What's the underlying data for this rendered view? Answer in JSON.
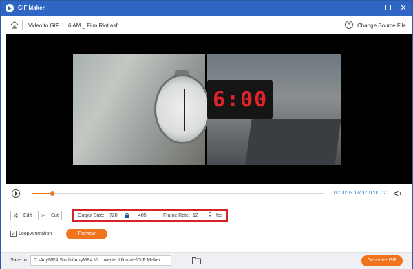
{
  "app": {
    "title": "GIF Maker",
    "max_glyph": "",
    "close_glyph": "✕"
  },
  "breadcrumb": {
    "section": "Video to GIF",
    "separator": "›",
    "file": "6 AM _ Film Riot.asf"
  },
  "header": {
    "change_source_label": "Change Source File",
    "change_source_glyph": "+"
  },
  "video": {
    "led_display": "6:00"
  },
  "player": {
    "current_time": "00:00:03.17",
    "total_time": "00:01:00.02",
    "time_display": "00:00:03.17/00:01:00.02",
    "progress_fraction": 0.07
  },
  "controls": {
    "edit_label": "Edit",
    "cut_label": "Cut",
    "output_size_label": "Output Size:",
    "output_width": "720",
    "output_height": "405",
    "frame_rate_label": "Frame Rate:",
    "frame_rate_value": "12",
    "frame_rate_unit": "fps",
    "loop_label": "Loop Animation",
    "loop_checked": true,
    "loop_glyph": "✓",
    "preview_label": "Preview"
  },
  "save": {
    "label": "Save to:",
    "path": "C:\\AnyMP4 Studio\\AnyMP4 Vi...nverter Ultimate\\GIF Maker",
    "browse_label": "···",
    "generate_label": "Generate GIF"
  },
  "colors": {
    "title_bar": "#2f66c4",
    "accent": "#f0741c",
    "highlight_border": "#d42329",
    "time_text": "#1f6fd1"
  },
  "icons": [
    "app-logo-icon",
    "home-icon",
    "add-circle-icon",
    "play-icon",
    "volume-icon",
    "edit-icon",
    "scissors-icon",
    "lock-icon",
    "stepper-icon",
    "checkbox-icon",
    "folder-icon"
  ]
}
